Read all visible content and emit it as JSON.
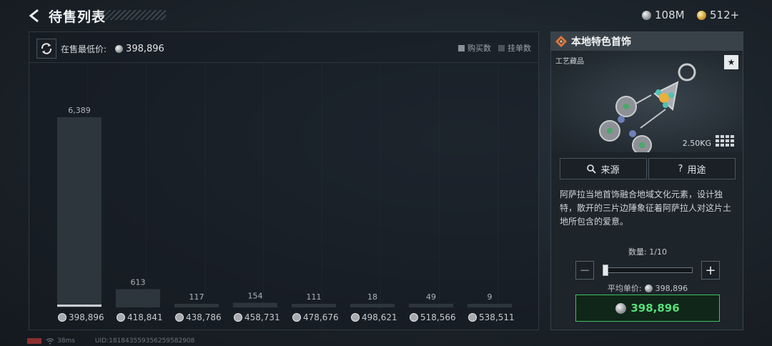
{
  "header": {
    "title": "待售列表",
    "silver_amount": "108M",
    "gold_amount": "512+"
  },
  "market": {
    "lowest_label": "在售最低价:",
    "lowest_price": "398,896",
    "legend": [
      {
        "label": "购买数",
        "color": "#8a9299"
      },
      {
        "label": "挂单数",
        "color": "#4b545b"
      }
    ]
  },
  "chart_data": {
    "type": "bar",
    "categories": [
      "398,896",
      "418,841",
      "438,786",
      "458,731",
      "478,676",
      "498,621",
      "518,566",
      "538,511"
    ],
    "series": [
      {
        "name": "挂单数",
        "values": [
          6389,
          613,
          117,
          154,
          111,
          18,
          49,
          9
        ]
      }
    ],
    "data_labels": [
      "6,389",
      "613",
      "117",
      "154",
      "111",
      "18",
      "49",
      "9"
    ],
    "xlabel": "",
    "ylabel": "",
    "ylim": [
      0,
      6389
    ],
    "grid": false,
    "legend_placement": "top-right"
  },
  "item": {
    "name": "本地特色首饰",
    "category": "工艺藏品",
    "favorite_icon": "★",
    "weight": "2.50KG",
    "source_label": "来源",
    "use_label": "用途",
    "description": "阿萨拉当地首饰融合地域文化元素，设计独特，散开的三片边陲象征着阿萨拉人对这片土地所包含的爱意。",
    "quantity_label": "数量: 1/10",
    "quantity_fraction": 0.1,
    "avg_price_label": "平均单价:",
    "avg_price": "398,896",
    "buy_price": "398,896"
  },
  "status": {
    "ping": "38ms",
    "uid": "UID:1818435593562595829​08"
  },
  "colors": {
    "accent_green": "#54e07a",
    "bar_fill": "#2e363d",
    "bar_highlight": "#c8ced3"
  }
}
